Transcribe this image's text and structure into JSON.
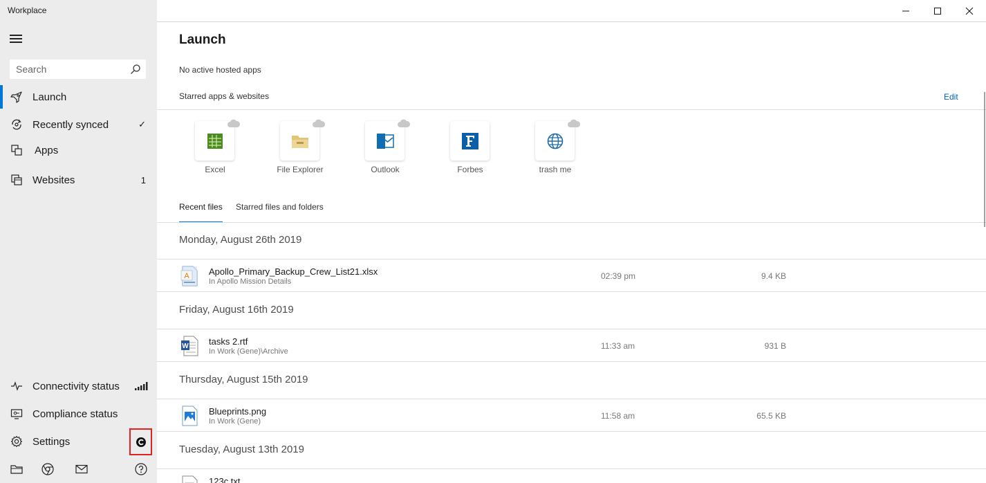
{
  "app": {
    "title": "Workplace"
  },
  "search": {
    "placeholder": "Search"
  },
  "nav": {
    "items": [
      {
        "label": "Launch",
        "icon": "rocket-icon",
        "active": true
      },
      {
        "label": "Recently synced",
        "icon": "sync-icon",
        "right": "✓"
      },
      {
        "label": "Apps",
        "icon": "apps-icon"
      },
      {
        "label": "Websites",
        "icon": "websites-icon",
        "right": "1"
      }
    ],
    "bottom": [
      {
        "label": "Connectivity status",
        "icon": "pulse-icon",
        "right_icon": "signal-bars-icon"
      },
      {
        "label": "Compliance status",
        "icon": "monitor-check-icon"
      },
      {
        "label": "Settings",
        "icon": "gear-icon",
        "badge_icon": "circular-c-icon"
      }
    ],
    "footer_icons": [
      "folder-icon",
      "chrome-icon",
      "mail-icon",
      "help-icon"
    ]
  },
  "accent_color": "#0078d7",
  "highlight_color": "#e0231e",
  "main": {
    "title": "Launch",
    "no_hosted": "No active hosted apps",
    "starred_label": "Starred apps & websites",
    "edit_label": "Edit",
    "apps": [
      {
        "label": "Excel",
        "icon": "excel-icon",
        "cloud": true
      },
      {
        "label": "File Explorer",
        "icon": "file-explorer-icon",
        "cloud": true
      },
      {
        "label": "Outlook",
        "icon": "outlook-icon",
        "cloud": true
      },
      {
        "label": "Forbes",
        "icon": "forbes-icon",
        "cloud": false
      },
      {
        "label": "trash me",
        "icon": "globe-icon",
        "cloud": true
      }
    ],
    "tabs": [
      {
        "label": "Recent files",
        "active": true
      },
      {
        "label": "Starred files and folders",
        "active": false
      }
    ],
    "groups": [
      {
        "date": "Monday, August 26th 2019",
        "files": [
          {
            "name": "Apollo_Primary_Backup_Crew_List21.xlsx",
            "path": "In Apollo Mission Details",
            "time": "02:39 pm",
            "size": "9.4 KB",
            "icon": "xlsx-file-icon"
          }
        ]
      },
      {
        "date": "Friday, August 16th 2019",
        "files": [
          {
            "name": "tasks 2.rtf",
            "path": "In Work (Gene)\\Archive",
            "time": "11:33 am",
            "size": "931 B",
            "icon": "word-file-icon"
          }
        ]
      },
      {
        "date": "Thursday, August 15th 2019",
        "files": [
          {
            "name": "Blueprints.png",
            "path": "In Work (Gene)",
            "time": "11:58 am",
            "size": "65.5 KB",
            "icon": "image-file-icon"
          }
        ]
      },
      {
        "date": "Tuesday, August 13th 2019",
        "files": [
          {
            "name": "123c.txt",
            "path": "",
            "time": "",
            "size": "",
            "icon": "text-file-icon"
          }
        ]
      }
    ]
  }
}
